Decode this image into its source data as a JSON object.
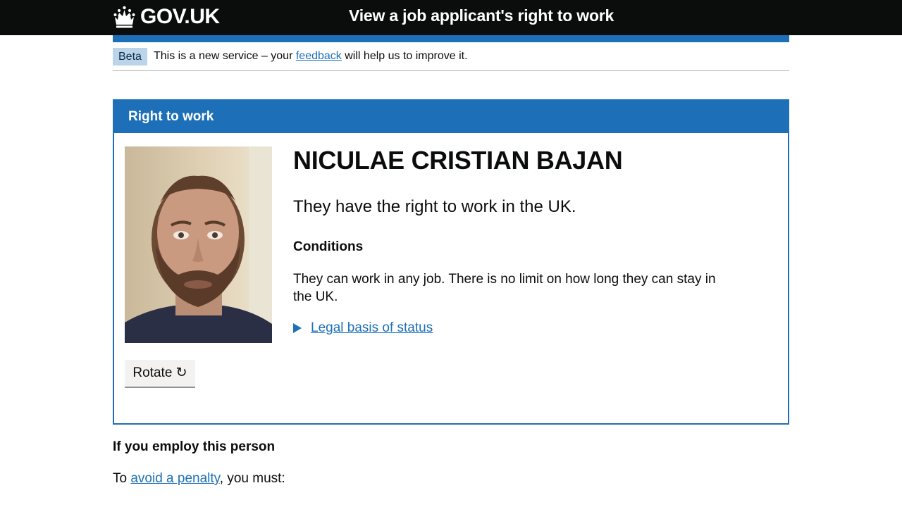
{
  "header": {
    "logo_text": "GOV.UK",
    "service_name": "View a job applicant's right to work"
  },
  "phase_banner": {
    "tag": "Beta",
    "text_before": "This is a new service – your",
    "link": "feedback",
    "text_after": "will help us to improve it."
  },
  "card": {
    "heading": "Right to work",
    "name": "NICULAE CRISTIAN BAJAN",
    "status": "They have the right to work in the UK.",
    "conditions_heading": "Conditions",
    "conditions_text": "They can work in any job. There is no limit on how long they can stay in the UK.",
    "legal_link": "Legal basis of status",
    "rotate_label": "Rotate ↻"
  },
  "employ": {
    "heading": "If you employ this person",
    "text_before": "To",
    "link": "avoid a penalty",
    "text_after": ", you must:"
  },
  "colors": {
    "brand_blue": "#1d70b8",
    "header_black": "#0b0c0c",
    "phase_tag_bg": "#bbd4ea"
  },
  "icons": {
    "logo": "crown-icon",
    "details": "triangle-right-icon"
  }
}
